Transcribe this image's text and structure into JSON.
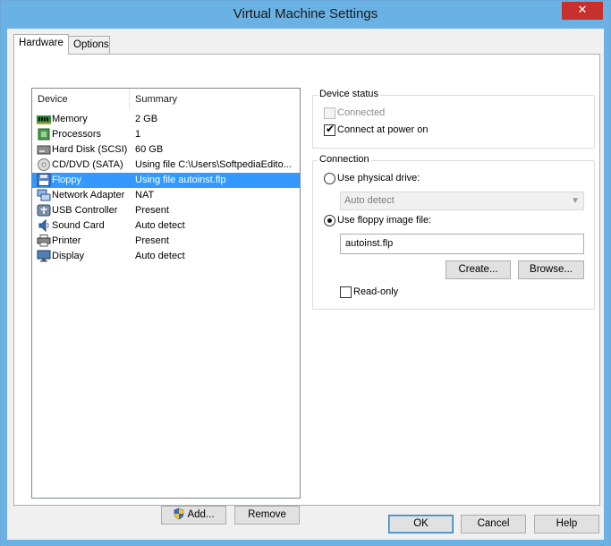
{
  "window": {
    "title": "Virtual Machine Settings",
    "close_glyph": "✕"
  },
  "tabs": [
    {
      "label": "Hardware",
      "selected": true
    },
    {
      "label": "Options",
      "selected": false
    }
  ],
  "device_list": {
    "columns": [
      "Device",
      "Summary"
    ],
    "rows": [
      {
        "device": "Memory",
        "summary": "2 GB",
        "icon": "memory-icon"
      },
      {
        "device": "Processors",
        "summary": "1",
        "icon": "processor-icon"
      },
      {
        "device": "Hard Disk (SCSI)",
        "summary": "60 GB",
        "icon": "hard-disk-icon"
      },
      {
        "device": "CD/DVD (SATA)",
        "summary": "Using file C:\\Users\\SoftpediaEdito...",
        "icon": "cd-dvd-icon"
      },
      {
        "device": "Floppy",
        "summary": "Using file autoinst.flp",
        "icon": "floppy-icon",
        "selected": true
      },
      {
        "device": "Network Adapter",
        "summary": "NAT",
        "icon": "network-adapter-icon"
      },
      {
        "device": "USB Controller",
        "summary": "Present",
        "icon": "usb-controller-icon"
      },
      {
        "device": "Sound Card",
        "summary": "Auto detect",
        "icon": "sound-card-icon"
      },
      {
        "device": "Printer",
        "summary": "Present",
        "icon": "printer-icon"
      },
      {
        "device": "Display",
        "summary": "Auto detect",
        "icon": "display-icon"
      }
    ]
  },
  "list_buttons": {
    "add": "Add...",
    "remove": "Remove"
  },
  "device_status": {
    "title": "Device status",
    "connected_label": "Connected",
    "connected_checked": false,
    "connected_enabled": false,
    "connect_at_power_on_label": "Connect at power on",
    "connect_at_power_on_checked": true
  },
  "connection": {
    "title": "Connection",
    "physical_drive_label": "Use physical drive:",
    "physical_drive_selected": false,
    "physical_drive_value": "Auto detect",
    "image_file_label": "Use floppy image file:",
    "image_file_selected": true,
    "image_file_value": "autoinst.flp",
    "create_label": "Create...",
    "browse_label": "Browse...",
    "read_only_label": "Read-only",
    "read_only_checked": false
  },
  "footer": {
    "ok": "OK",
    "cancel": "Cancel",
    "help": "Help"
  },
  "colors": {
    "titlebar": "#6ab1e4",
    "selection": "#3399ff",
    "close_button": "#c7302c"
  }
}
